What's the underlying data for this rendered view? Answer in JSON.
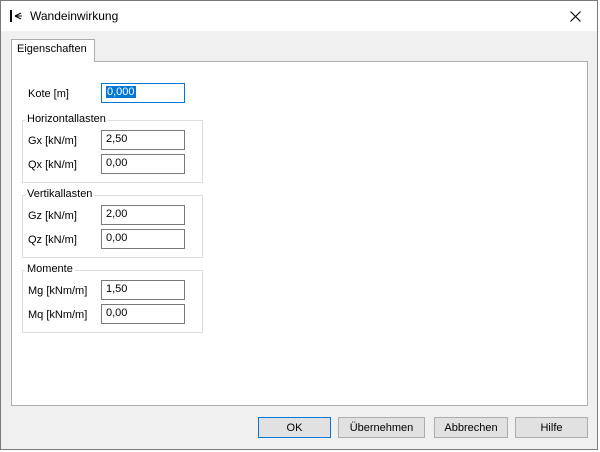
{
  "window": {
    "title": "Wandeinwirkung"
  },
  "tabs": [
    {
      "label": "Eigenschaften",
      "active": true
    }
  ],
  "kote": {
    "label": "Kote [m]",
    "value": "0,000"
  },
  "groups": {
    "horizontal": {
      "title": "Horizontallasten",
      "rows": [
        {
          "label": "Gx [kN/m]",
          "value": "2,50"
        },
        {
          "label": "Qx [kN/m]",
          "value": "0,00"
        }
      ]
    },
    "vertical": {
      "title": "Vertikallasten",
      "rows": [
        {
          "label": "Gz [kN/m]",
          "value": "2,00"
        },
        {
          "label": "Qz [kN/m]",
          "value": "0,00"
        }
      ]
    },
    "moments": {
      "title": "Momente",
      "rows": [
        {
          "label": "Mg [kNm/m]",
          "value": "1,50"
        },
        {
          "label": "Mq [kNm/m]",
          "value": "0,00"
        }
      ]
    }
  },
  "buttons": {
    "ok": "OK",
    "apply": "Übernehmen",
    "cancel": "Abbrechen",
    "help": "Hilfe"
  },
  "accent_color": "#0078d7"
}
